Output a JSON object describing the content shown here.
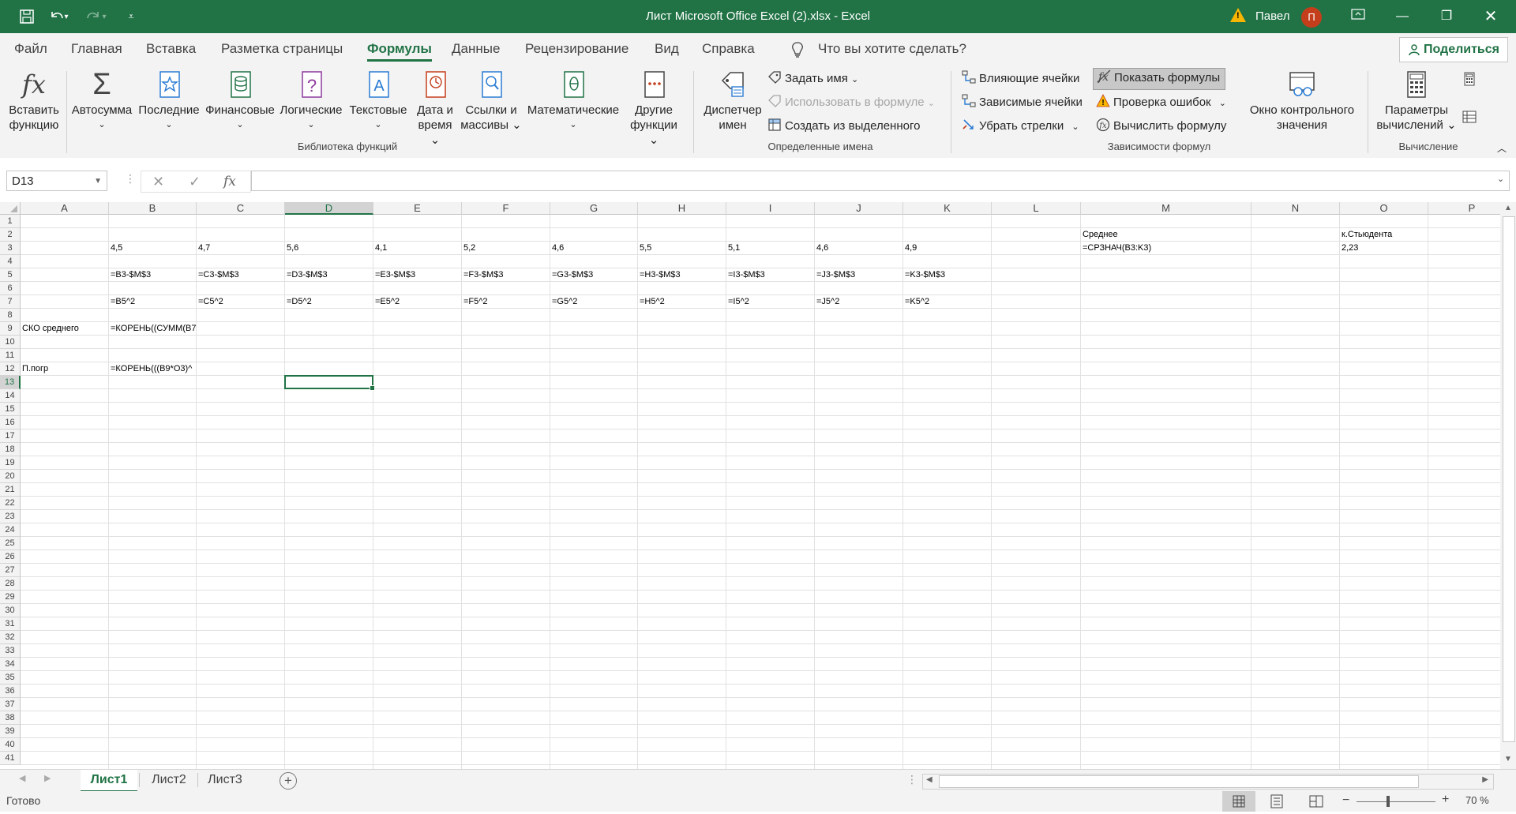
{
  "titlebar": {
    "title": "Лист Microsoft Office Excel (2).xlsx  -  Excel",
    "user": "Павел",
    "avatar": "П",
    "qat": [
      "save-icon",
      "undo-icon",
      "redo-icon",
      "customize-icon"
    ]
  },
  "menu": {
    "tabs": [
      "Файл",
      "Главная",
      "Вставка",
      "Разметка страницы",
      "Формулы",
      "Данные",
      "Рецензирование",
      "Вид",
      "Справка"
    ],
    "active": "Формулы",
    "search": "Что вы хотите сделать?",
    "share": "Поделиться"
  },
  "ribbon": {
    "insert_function": [
      "Вставить",
      "функцию"
    ],
    "autosum": "Автосумма",
    "recent": "Последние",
    "financial": "Финансовые",
    "logical": "Логические",
    "text": "Текстовые",
    "datetime": [
      "Дата и",
      "время"
    ],
    "lookup": [
      "Ссылки и",
      "массивы"
    ],
    "math": "Математические",
    "other": [
      "Другие",
      "функции"
    ],
    "group_library": "Библиотека функций",
    "name_manager": [
      "Диспетчер",
      "имен"
    ],
    "define_name": "Задать имя",
    "use_in_formula": "Использовать в формуле",
    "create_from_selection": "Создать из выделенного",
    "group_names": "Определенные имена",
    "trace_precedents": "Влияющие ячейки",
    "trace_dependents": "Зависимые ячейки",
    "remove_arrows": "Убрать стрелки",
    "show_formulas": "Показать формулы",
    "error_checking": "Проверка ошибок",
    "evaluate_formula": "Вычислить формулу",
    "watch_window": [
      "Окно контрольного",
      "значения"
    ],
    "group_auditing": "Зависимости формул",
    "calc_options": [
      "Параметры",
      "вычислений"
    ],
    "group_calc": "Вычисление"
  },
  "formula_bar": {
    "name_box": "D13",
    "content": ""
  },
  "columns": [
    "A",
    "B",
    "C",
    "D",
    "E",
    "F",
    "G",
    "H",
    "I",
    "J",
    "K",
    "L",
    "M",
    "N",
    "O",
    "P"
  ],
  "selected_col": "D",
  "selected_row": 13,
  "rows": [
    "1",
    "2",
    "3",
    "4",
    "5",
    "6",
    "7",
    "8",
    "9",
    "10",
    "11",
    "12",
    "13",
    "14",
    "15",
    "16",
    "17",
    "18",
    "19",
    "20",
    "21",
    "22",
    "23",
    "24",
    "25",
    "26",
    "27",
    "28",
    "29",
    "30",
    "31",
    "32",
    "33",
    "34",
    "35",
    "36",
    "37",
    "38",
    "39",
    "40",
    "41"
  ],
  "cells": [
    {
      "ref": "M2",
      "col": 12,
      "row": 2,
      "value": "Среднее"
    },
    {
      "ref": "O2",
      "col": 14,
      "row": 2,
      "value": "к.Стьюдента"
    },
    {
      "ref": "B3",
      "col": 1,
      "row": 3,
      "value": "4,5"
    },
    {
      "ref": "C3",
      "col": 2,
      "row": 3,
      "value": "4,7"
    },
    {
      "ref": "D3",
      "col": 3,
      "row": 3,
      "value": "5,6"
    },
    {
      "ref": "E3",
      "col": 4,
      "row": 3,
      "value": "4,1"
    },
    {
      "ref": "F3",
      "col": 5,
      "row": 3,
      "value": "5,2"
    },
    {
      "ref": "G3",
      "col": 6,
      "row": 3,
      "value": "4,6"
    },
    {
      "ref": "H3",
      "col": 7,
      "row": 3,
      "value": "5,5"
    },
    {
      "ref": "I3",
      "col": 8,
      "row": 3,
      "value": "5,1"
    },
    {
      "ref": "J3",
      "col": 9,
      "row": 3,
      "value": "4,6"
    },
    {
      "ref": "K3",
      "col": 10,
      "row": 3,
      "value": "4,9"
    },
    {
      "ref": "M3",
      "col": 12,
      "row": 3,
      "value": "=СРЗНАЧ(B3:K3)"
    },
    {
      "ref": "O3",
      "col": 14,
      "row": 3,
      "value": "2,23"
    },
    {
      "ref": "B5",
      "col": 1,
      "row": 5,
      "value": "=B3-$M$3"
    },
    {
      "ref": "C5",
      "col": 2,
      "row": 5,
      "value": "=C3-$M$3"
    },
    {
      "ref": "D5",
      "col": 3,
      "row": 5,
      "value": "=D3-$M$3"
    },
    {
      "ref": "E5",
      "col": 4,
      "row": 5,
      "value": "=E3-$M$3"
    },
    {
      "ref": "F5",
      "col": 5,
      "row": 5,
      "value": "=F3-$M$3"
    },
    {
      "ref": "G5",
      "col": 6,
      "row": 5,
      "value": "=G3-$M$3"
    },
    {
      "ref": "H5",
      "col": 7,
      "row": 5,
      "value": "=H3-$M$3"
    },
    {
      "ref": "I5",
      "col": 8,
      "row": 5,
      "value": "=I3-$M$3"
    },
    {
      "ref": "J5",
      "col": 9,
      "row": 5,
      "value": "=J3-$M$3"
    },
    {
      "ref": "K5",
      "col": 10,
      "row": 5,
      "value": "=K3-$M$3"
    },
    {
      "ref": "B7",
      "col": 1,
      "row": 7,
      "value": "=B5^2"
    },
    {
      "ref": "C7",
      "col": 2,
      "row": 7,
      "value": "=C5^2"
    },
    {
      "ref": "D7",
      "col": 3,
      "row": 7,
      "value": "=D5^2"
    },
    {
      "ref": "E7",
      "col": 4,
      "row": 7,
      "value": "=E5^2"
    },
    {
      "ref": "F7",
      "col": 5,
      "row": 7,
      "value": "=F5^2"
    },
    {
      "ref": "G7",
      "col": 6,
      "row": 7,
      "value": "=G5^2"
    },
    {
      "ref": "H7",
      "col": 7,
      "row": 7,
      "value": "=H5^2"
    },
    {
      "ref": "I7",
      "col": 8,
      "row": 7,
      "value": "=I5^2"
    },
    {
      "ref": "J7",
      "col": 9,
      "row": 7,
      "value": "=J5^2"
    },
    {
      "ref": "K7",
      "col": 10,
      "row": 7,
      "value": "=K5^2"
    },
    {
      "ref": "A9",
      "col": 0,
      "row": 9,
      "value": "СКО среднего"
    },
    {
      "ref": "B9",
      "col": 1,
      "row": 9,
      "value": "=КОРЕНЬ((СУММ(B7"
    },
    {
      "ref": "A12",
      "col": 0,
      "row": 12,
      "value": "П.погр"
    },
    {
      "ref": "B12",
      "col": 1,
      "row": 12,
      "value": "=КОРЕНЬ(((B9*O3)^"
    }
  ],
  "sheets": [
    "Лист1",
    "Лист2",
    "Лист3"
  ],
  "active_sheet": "Лист1",
  "status": {
    "ready": "Готово",
    "zoom": "70 %"
  }
}
